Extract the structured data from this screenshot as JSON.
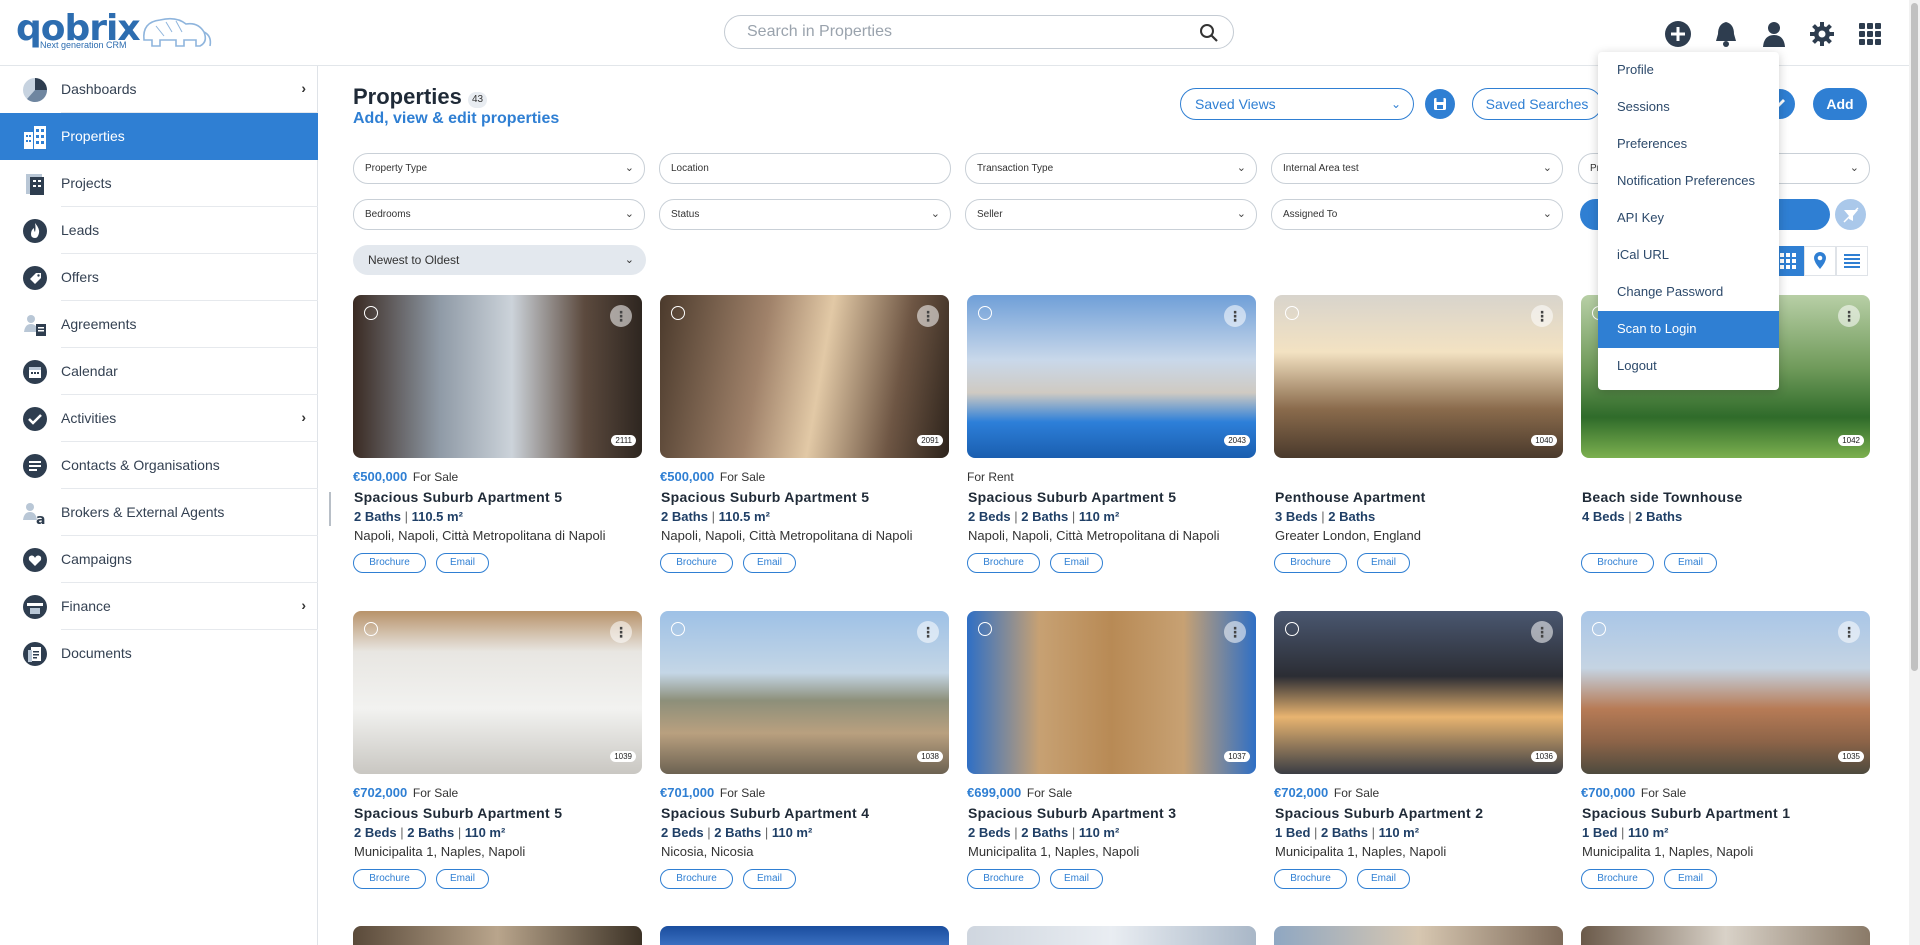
{
  "app": {
    "logo_text": "qobrix",
    "logo_tagline": "Next generation CRM",
    "accent": "#2f7fd3"
  },
  "search": {
    "placeholder": "Search in Properties",
    "value": ""
  },
  "top_icons": [
    "plus-circle-icon",
    "bell-icon",
    "user-icon",
    "gear-icon",
    "apps-grid-icon"
  ],
  "sidebar": {
    "items": [
      {
        "label": "Dashboards",
        "icon": "pie-chart-icon",
        "has_submenu": true,
        "active": false
      },
      {
        "label": "Properties",
        "icon": "building-icon",
        "has_submenu": false,
        "active": true
      },
      {
        "label": "Projects",
        "icon": "projects-icon",
        "has_submenu": false,
        "active": false
      },
      {
        "label": "Leads",
        "icon": "flame-icon",
        "has_submenu": false,
        "active": false
      },
      {
        "label": "Offers",
        "icon": "tag-icon",
        "has_submenu": false,
        "active": false
      },
      {
        "label": "Agreements",
        "icon": "agreements-icon",
        "has_submenu": false,
        "active": false
      },
      {
        "label": "Calendar",
        "icon": "calendar-icon",
        "has_submenu": false,
        "active": false
      },
      {
        "label": "Activities",
        "icon": "check-circle-icon",
        "has_submenu": true,
        "active": false
      },
      {
        "label": "Contacts & Organisations",
        "icon": "contacts-icon",
        "has_submenu": false,
        "active": false
      },
      {
        "label": "Brokers & External Agents",
        "icon": "brokers-icon",
        "has_submenu": false,
        "active": false
      },
      {
        "label": "Campaigns",
        "icon": "heart-icon",
        "has_submenu": false,
        "active": false
      },
      {
        "label": "Finance",
        "icon": "finance-icon",
        "has_submenu": true,
        "active": false
      },
      {
        "label": "Documents",
        "icon": "documents-icon",
        "has_submenu": false,
        "active": false
      }
    ]
  },
  "header": {
    "title": "Properties",
    "count": "43",
    "subtitle": "Add, view & edit properties",
    "saved_views_label": "Saved Views",
    "saved_searches_label": "Saved Searches",
    "add_label": "Add"
  },
  "filters": {
    "row1": [
      "Property Type",
      "Location",
      "Transaction Type",
      "Internal Area test",
      "Pr"
    ],
    "row2": [
      "Bedrooms",
      "Status",
      "Seller",
      "Assigned To"
    ],
    "sort": "Newest to Oldest"
  },
  "view_toggles": [
    "grid-icon",
    "map-pin-icon",
    "list-icon"
  ],
  "cards": [
    {
      "price": "€500,000",
      "status": "For Sale",
      "name": "Spacious Suburb Apartment 5",
      "specs": [
        "2 Baths",
        "110.5 m²"
      ],
      "location": "Napoli, Napoli, Città Metropolitana di Napoli",
      "ref": "2111",
      "brochure": "Brochure",
      "email": "Email",
      "img": "kitchen"
    },
    {
      "price": "€500,000",
      "status": "For Sale",
      "name": "Spacious Suburb Apartment 5",
      "specs": [
        "2 Baths",
        "110.5 m²"
      ],
      "location": "Napoli, Napoli, Città Metropolitana di Napoli",
      "ref": "2091",
      "brochure": "Brochure",
      "email": "Email",
      "img": "lounge"
    },
    {
      "price": "",
      "status": "For Rent",
      "name": "Spacious Suburb Apartment 5",
      "specs": [
        "2 Beds",
        "2 Baths",
        "110 m²"
      ],
      "location": "Napoli, Napoli, Città Metropolitana di Napoli",
      "ref": "2043",
      "brochure": "Brochure",
      "email": "Email",
      "img": "pool"
    },
    {
      "price": "",
      "status": "",
      "name": "Penthouse Apartment",
      "specs": [
        "3 Beds",
        "2 Baths"
      ],
      "location": "Greater London, England",
      "ref": "1040",
      "brochure": "Brochure",
      "email": "Email",
      "img": "patio"
    },
    {
      "price": "",
      "status": "",
      "name": "Beach side Townhouse",
      "specs": [
        "4 Beds",
        "2 Baths"
      ],
      "location": "",
      "ref": "1042",
      "brochure": "Brochure",
      "email": "Email",
      "img": "garden"
    },
    {
      "price": "€702,000",
      "status": "For Sale",
      "name": "Spacious Suburb Apartment 5",
      "specs": [
        "2 Beds",
        "2 Baths",
        "110 m²"
      ],
      "location": "Municipalita 1, Naples, Napoli",
      "ref": "1039",
      "brochure": "Brochure",
      "email": "Email",
      "img": "white"
    },
    {
      "price": "€701,000",
      "status": "For Sale",
      "name": "Spacious Suburb Apartment 4",
      "specs": [
        "2 Beds",
        "2 Baths",
        "110 m²"
      ],
      "location": "Nicosia, Nicosia",
      "ref": "1038",
      "brochure": "Brochure",
      "email": "Email",
      "img": "naples"
    },
    {
      "price": "€699,000",
      "status": "For Sale",
      "name": "Spacious Suburb Apartment 3",
      "specs": [
        "2 Beds",
        "2 Baths",
        "110 m²"
      ],
      "location": "Municipalita 1, Naples, Napoli",
      "ref": "1037",
      "brochure": "Brochure",
      "email": "Email",
      "img": "tower"
    },
    {
      "price": "€702,000",
      "status": "For Sale",
      "name": "Spacious Suburb Apartment 2",
      "specs": [
        "1 Bed",
        "2 Baths",
        "110 m²"
      ],
      "location": "Municipalita 1, Naples, Napoli",
      "ref": "1036",
      "brochure": "Brochure",
      "email": "Email",
      "img": "modern"
    },
    {
      "price": "€700,000",
      "status": "For Sale",
      "name": "Spacious Suburb Apartment 1",
      "specs": [
        "1 Bed",
        "110 m²"
      ],
      "location": "Municipalita 1, Naples, Napoli",
      "ref": "1035",
      "brochure": "Brochure",
      "email": "Email",
      "img": "city"
    }
  ],
  "user_menu": {
    "items": [
      "Profile",
      "Sessions",
      "Preferences",
      "Notification Preferences",
      "API Key",
      "iCal URL",
      "Change Password",
      "Scan to Login",
      "Logout"
    ],
    "highlighted": "Scan to Login"
  }
}
